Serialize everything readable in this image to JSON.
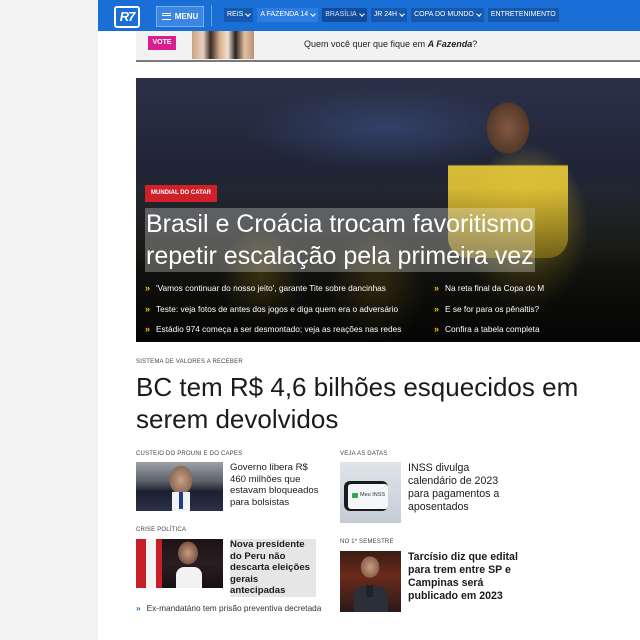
{
  "brand": {
    "logo": "R7"
  },
  "nav": {
    "menu_label": "MENU",
    "tabs": [
      "REIS",
      "A FAZENDA 14",
      "BRASÍLIA",
      "JR 24H",
      "COPA DO MUNDO",
      "ENTRETENIMENTO"
    ]
  },
  "vote_banner": {
    "badge": "VOTE",
    "text_prefix": "Quem você quer que fique em ",
    "text_emphasis": "A Fazenda",
    "text_suffix": "?"
  },
  "hero": {
    "kicker": "MUNDIAL DO CATAR",
    "title_line1": "Brasil e Croácia trocam favoritismo",
    "title_line2": "repetir escalação pela primeira vez",
    "links_left": [
      "'Vamos continuar do nosso jeito', garante Tite sobre dancinhas",
      "Teste: veja fotos de antes dos jogos e diga quem era o adversário",
      "Estádio 974 começa a ser desmontado; veja as reações nas redes"
    ],
    "links_right": [
      "Na reta final da Copa do M",
      "E se for para os pênaltis?",
      "Confira a tabela completa"
    ]
  },
  "main_story": {
    "kicker": "SISTEMA DE VALORES A RECEBER",
    "title_line1": "BC tem R$ 4,6 bilhões esquecidos em",
    "title_line2": "serem devolvidos"
  },
  "cards": [
    {
      "kicker": "CUSTEIO DO PROUNI E DO CAPES",
      "title": "Governo libera R$ 460 milhões que estavam bloqueados para bolsistas"
    },
    {
      "kicker": "VEJA AS DATAS",
      "title": "INSS divulga calendário de 2023 para pagamentos a aposentados",
      "thumb_label": "Meu INSS"
    },
    {
      "kicker": "CRISE POLÍTICA",
      "title": "Nova presidente do Peru não descarta eleições gerais antecipadas"
    },
    {
      "kicker": "NO 1º SEMESTRE",
      "title": "Tarcísio diz que edital para trem entre SP e Campinas será publicado em 2023"
    }
  ],
  "bottom_link": "Ex-mandatário tem prisão preventiva decretada",
  "colors": {
    "brand_blue": "#1a6fd6",
    "kicker_red": "#d0202a",
    "vote_pink": "#d91e8f",
    "arrow_yellow": "#f2c200"
  }
}
